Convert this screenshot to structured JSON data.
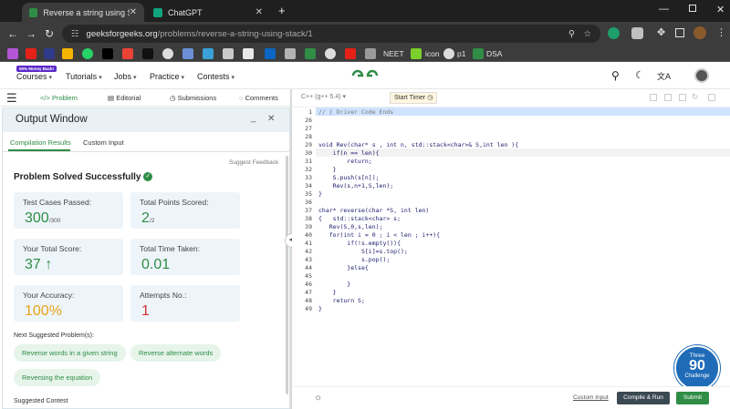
{
  "browser": {
    "tabs": [
      {
        "title": "Reverse a string using Stack | P"
      },
      {
        "title": "ChatGPT"
      }
    ],
    "url_host": "geeksforgeeks.org",
    "url_path": "/problems/reverse-a-string-using-stack/1",
    "bookmarks": [
      {
        "label": "NEET"
      },
      {
        "label": "icon"
      },
      {
        "label": "p1"
      },
      {
        "label": "DSA"
      }
    ]
  },
  "site": {
    "badge": "50% Money Back!",
    "menu": [
      "Courses",
      "Tutorials",
      "Jobs",
      "Practice",
      "Contests"
    ]
  },
  "problem_tabs": [
    "Problem",
    "Editorial",
    "Submissions",
    "Comments"
  ],
  "output": {
    "title": "Output Window",
    "tabs": [
      "Compilation Results",
      "Custom Input"
    ],
    "suggest": "Suggest Feedback",
    "status": "Problem Solved Successfully",
    "cards": [
      {
        "label": "Test Cases Passed:",
        "value": "300",
        "sub": "/300",
        "color": "#2f8d46"
      },
      {
        "label": "Total Points Scored:",
        "value": "2",
        "sub": "/2",
        "color": "#2f8d46"
      },
      {
        "label": "Your Total Score:",
        "value": "37",
        "sub": "",
        "color": "#2f8d46"
      },
      {
        "label": "Total Time Taken:",
        "value": "0.01",
        "sub": "",
        "color": "#2f8d46"
      },
      {
        "label": "Your Accuracy:",
        "value": "100%",
        "sub": "",
        "color": "#e8a317"
      },
      {
        "label": "Attempts No.:",
        "value": "1",
        "sub": "",
        "color": "#d32f2f"
      }
    ],
    "next_title": "Next Suggested Problem(s):",
    "next": [
      "Reverse words in a given string",
      "Reverse alternate words",
      "Reversing the equation"
    ],
    "cut_text": "Suggested Contest"
  },
  "editor": {
    "language": "C++ (g++ 5.4)",
    "timer": "Start Timer",
    "lines": [
      {
        "n": "1",
        "t": "// } Driver Code Ends"
      },
      {
        "n": "26",
        "t": ""
      },
      {
        "n": "27",
        "t": ""
      },
      {
        "n": "28",
        "t": ""
      },
      {
        "n": "29",
        "t": "void Rev(char* s , int n, std::stack<char>& S,int len ){"
      },
      {
        "n": "30",
        "t": "    if(n == len){"
      },
      {
        "n": "31",
        "t": "        return;"
      },
      {
        "n": "32",
        "t": "    }"
      },
      {
        "n": "33",
        "t": "    S.push(s[n]);"
      },
      {
        "n": "34",
        "t": "    Rev(s,n+1,S,len);"
      },
      {
        "n": "35",
        "t": "}"
      },
      {
        "n": "36",
        "t": ""
      },
      {
        "n": "37",
        "t": "char* reverse(char *S, int len)"
      },
      {
        "n": "38",
        "t": "{   std::stack<char> s;"
      },
      {
        "n": "39",
        "t": "   Rev(S,0,s,len);"
      },
      {
        "n": "40",
        "t": "   for(int i = 0 ; i < len ; i++){"
      },
      {
        "n": "41",
        "t": "        if(!s.empty()){"
      },
      {
        "n": "42",
        "t": "            S[i]=s.top();"
      },
      {
        "n": "43",
        "t": "            s.pop();"
      },
      {
        "n": "44",
        "t": "        }else{"
      },
      {
        "n": "45",
        "t": ""
      },
      {
        "n": "46",
        "t": "        }"
      },
      {
        "n": "47",
        "t": "    }"
      },
      {
        "n": "48",
        "t": "    return S;"
      },
      {
        "n": "49",
        "t": "}"
      }
    ],
    "custom_input": "Custom Input",
    "compile": "Compile & Run",
    "submit": "Submit",
    "promo_top": "Three",
    "promo_num": "90",
    "promo_bottom": "Challenge"
  },
  "colors": {
    "gfg_green": "#2f8d46",
    "dark_chrome": "#3c3c3c"
  }
}
